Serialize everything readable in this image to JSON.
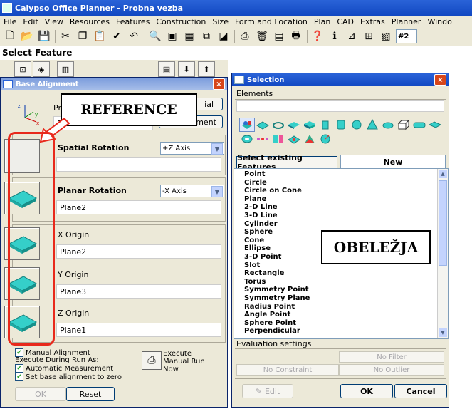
{
  "app": {
    "title": "Calypso Office Planner - Probna vezba",
    "menu": [
      "File",
      "Edit",
      "View",
      "Resources",
      "Features",
      "Construction",
      "Size",
      "Form and Location",
      "Plan",
      "CAD",
      "Extras",
      "Planner",
      "Windo"
    ],
    "toolbar_combo": "#2",
    "status_title": "Select Feature"
  },
  "base_alignment": {
    "title": "Base Alignment",
    "close": "×",
    "pr_label": "Pr",
    "pr_field": "P",
    "btn_ial": "ial",
    "btn_ment": "ment",
    "rows": [
      {
        "label": "Spatial Rotation",
        "combo": "+Z Axis",
        "value": ""
      },
      {
        "label": "Planar Rotation",
        "combo": "-X Axis",
        "value": "Plane2"
      },
      {
        "label": "X Origin",
        "value": "Plane2"
      },
      {
        "label": "Y Origin",
        "value": "Plane3"
      },
      {
        "label": "Z Origin",
        "value": "Plane1"
      }
    ],
    "manual_alignment": "Manual Alignment",
    "execute_during_run_as": "Execute During Run As:",
    "automatic_measurement": "Automatic Measurement",
    "set_base_zero": "Set base alignment to zero",
    "execute_manual_run_now": [
      "Execute",
      "Manual Run",
      "Now"
    ],
    "ok": "OK",
    "reset": "Reset"
  },
  "annotations": {
    "reference": "REFERENCE",
    "obelezja": "OBELEŽJA",
    "accent": "#e8291c"
  },
  "selection": {
    "title": "Selection",
    "close": "×",
    "elements_label": "Elements",
    "tab_existing": "Select existing Features",
    "tab_new": "New",
    "features": [
      "Point",
      "Circle",
      "Circle on Cone",
      "Plane",
      "2-D Line",
      "3-D Line",
      "Cylinder",
      "Sphere",
      "Cone",
      "Ellipse",
      "3-D Point",
      "Slot",
      "Rectangle",
      "Torus",
      "Symmetry Point",
      "Symmetry Plane",
      "Radius Point",
      "Angle Point",
      "Sphere Point",
      "Perpendicular"
    ],
    "evaluation_settings": "Evaluation settings",
    "no_filter": "No Filter",
    "no_constraint": "No Constraint",
    "no_outlier": "No Outlier",
    "edit": "Edit",
    "ok": "OK",
    "cancel": "Cancel"
  }
}
